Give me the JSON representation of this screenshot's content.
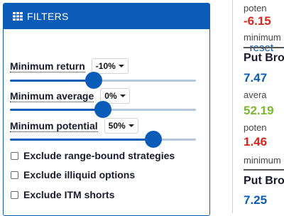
{
  "filters_panel": {
    "title": "FILTERS",
    "reset_label": "reset",
    "sliders": [
      {
        "label": "Minimum return",
        "value": "-10%",
        "level": 0.45
      },
      {
        "label": "Minimum average",
        "value": "0%",
        "level": 0.5
      },
      {
        "label": "Minimum potential",
        "value": "50%",
        "level": 0.77
      }
    ],
    "checkboxes": [
      {
        "label": "Exclude range-bound strategies",
        "checked": false
      },
      {
        "label": "Exclude illiquid options",
        "checked": false
      },
      {
        "label": "Exclude ITM shorts",
        "checked": false
      }
    ]
  },
  "results_column": {
    "items": [
      {
        "kind": "label",
        "text": "poten"
      },
      {
        "kind": "value",
        "text": "-6.15",
        "color": "#d9261c"
      },
      {
        "kind": "label",
        "text": "minimum"
      },
      {
        "kind": "title",
        "text": "Put Bro"
      },
      {
        "kind": "value",
        "text": "7.47",
        "color": "#0b5cb8"
      },
      {
        "kind": "label",
        "text": "avera"
      },
      {
        "kind": "value",
        "text": "52.19",
        "color": "#7cb82f"
      },
      {
        "kind": "label",
        "text": "poten"
      },
      {
        "kind": "value",
        "text": "1.46",
        "color": "#d9261c"
      },
      {
        "kind": "label",
        "text": "minimum"
      },
      {
        "kind": "title",
        "text": "Put Bro"
      },
      {
        "kind": "value",
        "text": "7.25",
        "color": "#0b5cb8"
      }
    ]
  },
  "colors": {
    "accent": "#0b5cb8",
    "negative": "#d9261c",
    "positive": "#7cb82f"
  }
}
